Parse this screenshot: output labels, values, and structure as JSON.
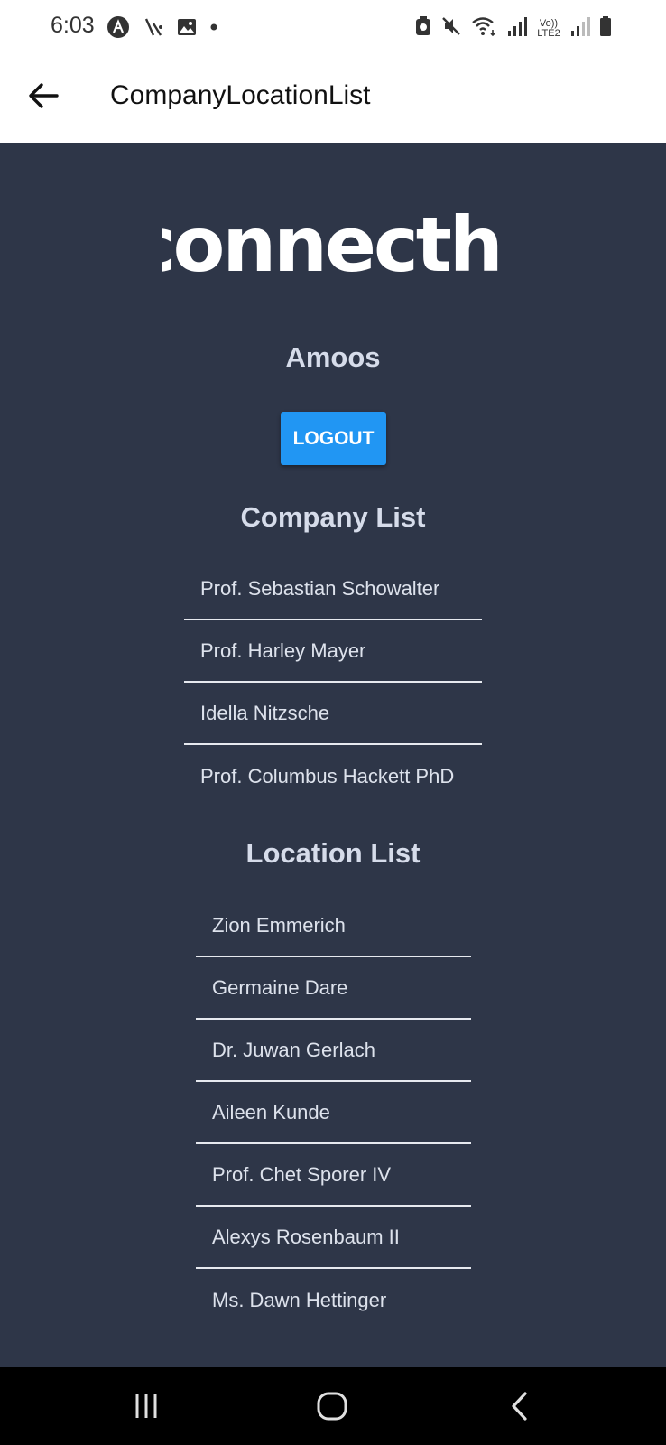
{
  "status_bar": {
    "time": "6:03",
    "left_icons": [
      "app-a-icon",
      "signal-slash-icon",
      "image-icon",
      "dot-icon"
    ],
    "right_icons": [
      "alarm-icon",
      "mute-icon",
      "wifi-icon",
      "signal-icon",
      "volte-icon",
      "signal-icon",
      "battery-icon"
    ],
    "volte_text": "Vo)) LTE2"
  },
  "app_bar": {
    "title": "CompanyLocationList"
  },
  "main": {
    "logo_text": "connecthr",
    "user_name": "Amoos",
    "logout_label": "LOGOUT",
    "company_list_title": "Company List",
    "companies": [
      "Prof. Sebastian Schowalter",
      "Prof. Harley Mayer",
      "Idella Nitzsche",
      "Prof. Columbus Hackett PhD"
    ],
    "location_list_title": "Location List",
    "locations": [
      "Zion Emmerich",
      "Germaine Dare",
      "Dr. Juwan Gerlach",
      "Aileen Kunde",
      "Prof. Chet Sporer IV",
      "Alexys Rosenbaum II",
      "Ms. Dawn Hettinger"
    ]
  },
  "nav_bar": {
    "buttons": [
      "recents-icon",
      "home-icon",
      "back-icon"
    ]
  },
  "colors": {
    "background": "#2e3648",
    "accent": "#2196f3",
    "heading": "#d6dcea",
    "list_text": "#dde2ec"
  }
}
